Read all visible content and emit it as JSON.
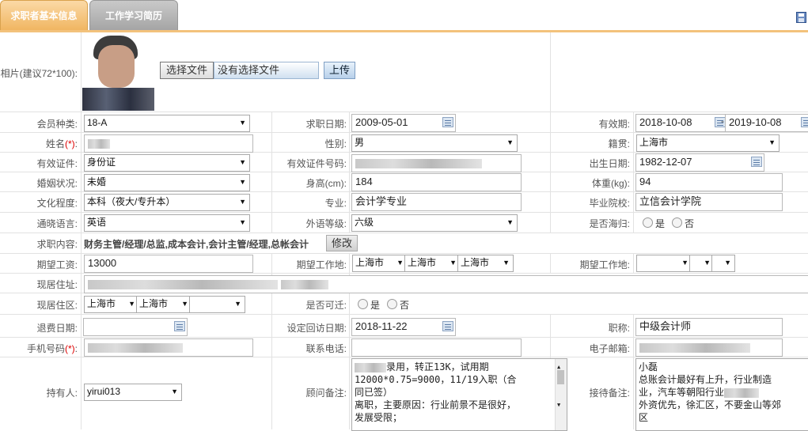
{
  "tabs": [
    {
      "label": "求职者基本信息"
    },
    {
      "label": "工作学习简历"
    }
  ],
  "save_icon": "save-icon",
  "photo": {
    "label": "相片(建议72*100):",
    "choose_btn": "选择文件",
    "no_file": "没有选择文件",
    "upload_btn": "上传"
  },
  "row1": {
    "member_type_label": "会员种类:",
    "member_type": "18-A",
    "job_date_label": "求职日期:",
    "job_date": "2009-05-01",
    "valid_label": "有效期:",
    "valid_from": "2018-10-08",
    "valid_sep": "-",
    "valid_to": "2019-10-08"
  },
  "row2": {
    "name_label": "姓名",
    "req_mark": "(*)",
    "colon": ":",
    "gender_label": "性别:",
    "gender": "男",
    "native_label": "籍贯:",
    "native": "上海市"
  },
  "row3": {
    "id_type_label": "有效证件:",
    "id_type": "身份证",
    "id_no_label": "有效证件号码:",
    "birth_label": "出生日期:",
    "birth": "1982-12-07"
  },
  "row4": {
    "marital_label": "婚姻状况:",
    "marital": "未婚",
    "height_label": "身高(cm):",
    "height": "184",
    "weight_label": "体重(kg):",
    "weight": "94"
  },
  "row5": {
    "edu_label": "文化程度:",
    "edu": "本科（夜大/专升本）",
    "major_label": "专业:",
    "major": "会计学专业",
    "school_label": "毕业院校:",
    "school": "立信会计学院"
  },
  "row6": {
    "lang_label": "通晓语言:",
    "lang": "英语",
    "level_label": "外语等级:",
    "level": "六级",
    "overseas_label": "是否海归:",
    "yes": "是",
    "no": "否"
  },
  "row7": {
    "content_label": "求职内容:",
    "content": "财务主管/经理/总监,成本会计,会计主管/经理,总帐会计",
    "modify_btn": "修改"
  },
  "row8": {
    "salary_label": "期望工资:",
    "salary": "13000",
    "loc1_label": "期望工作地:",
    "loc1": [
      "上海市",
      "上海市",
      "上海市"
    ],
    "loc2_label": "期望工作地:"
  },
  "row9": {
    "address_label": "现居住址:"
  },
  "row10": {
    "district_label": "现居住区:",
    "district": [
      "上海市",
      "上海市",
      ""
    ],
    "relocate_label": "是否可迁:",
    "yes": "是",
    "no": "否"
  },
  "row11": {
    "refund_label": "退费日期:",
    "revisit_label": "设定回访日期:",
    "revisit": "2018-11-22",
    "title_label": "职称:",
    "title": "中级会计师"
  },
  "row12": {
    "mobile_label": "手机号码",
    "req_mark": "(*)",
    "colon": ":",
    "phone_label": "联系电话:",
    "email_label": "电子邮箱:"
  },
  "row13": {
    "holder_label": "持有人:",
    "holder": "yirui013",
    "advisor_label": "顾问备注:",
    "advisor_note": [
      "录用，转正13K，试用期",
      "12000*0.75=9000，11/19入职（合",
      "同已签）",
      "离职，主要原因：行业前景不是很好，",
      "发展受限；"
    ],
    "reception_label": "接待备注:",
    "reception_note": [
      "小磊",
      "总账会计最好有上升，行业制造",
      "业，汽车等朝阳行业",
      "外资优先，徐汇区，不要金山等郊",
      "区"
    ]
  }
}
